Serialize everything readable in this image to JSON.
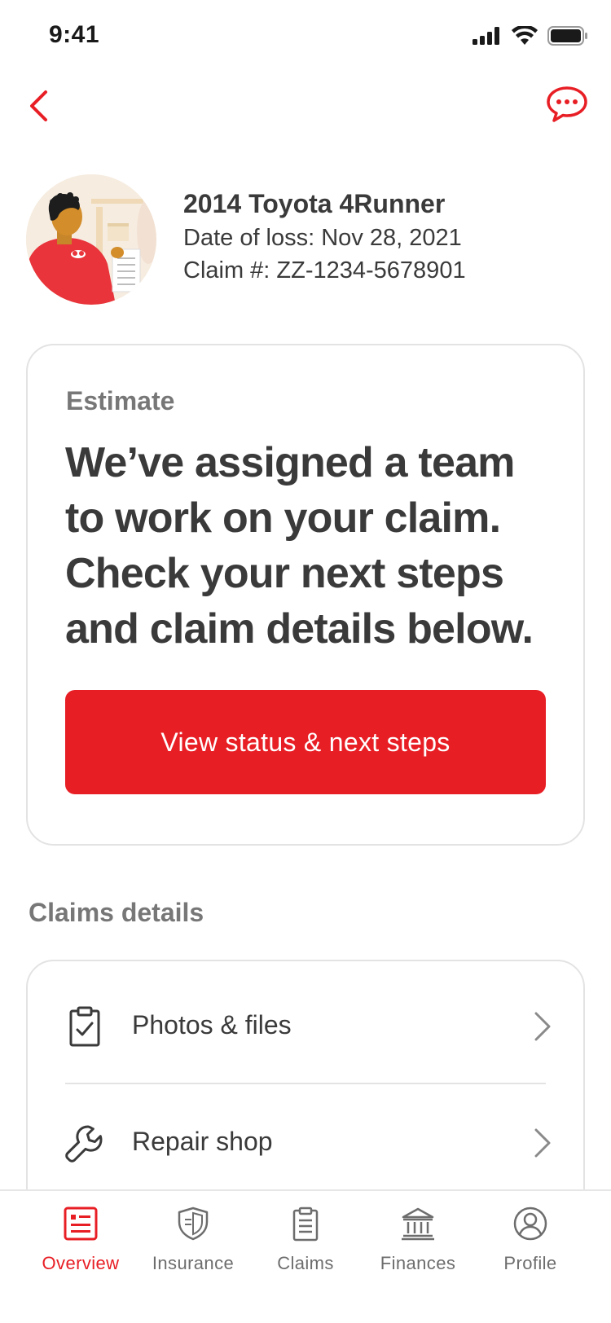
{
  "status_bar": {
    "time": "9:41"
  },
  "claim": {
    "vehicle": "2014 Toyota 4Runner",
    "date_of_loss": "Date of loss: Nov 28, 2021",
    "claim_number": "Claim #: ZZ-1234-5678901"
  },
  "estimate_card": {
    "label": "Estimate",
    "message": "We’ve assigned a team to work on your claim. Check your next steps and claim details below.",
    "button_label": "View status & next steps"
  },
  "claims_details": {
    "title": "Claims details",
    "items": [
      {
        "label": "Photos & files",
        "icon": "clipboard-check-icon"
      },
      {
        "label": "Repair shop",
        "icon": "wrench-icon"
      }
    ]
  },
  "tab_bar": {
    "items": [
      {
        "label": "Overview",
        "icon": "overview-icon",
        "active": true
      },
      {
        "label": "Insurance",
        "icon": "shield-icon",
        "active": false
      },
      {
        "label": "Claims",
        "icon": "claims-clipboard-icon",
        "active": false
      },
      {
        "label": "Finances",
        "icon": "bank-icon",
        "active": false
      },
      {
        "label": "Profile",
        "icon": "profile-icon",
        "active": false
      }
    ]
  },
  "colors": {
    "brand_red": "#e81e25",
    "text_dark": "#3a3a3a",
    "text_muted": "#777777",
    "border": "#e3e3e3"
  }
}
